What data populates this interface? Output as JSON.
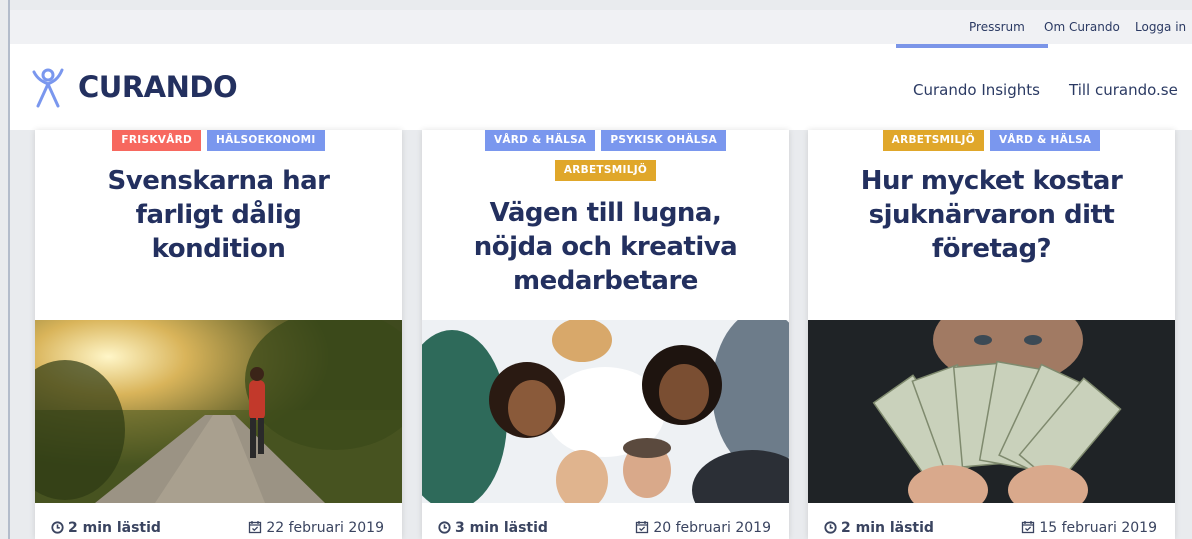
{
  "utility_nav": {
    "pressroom": "Pressrum",
    "about": "Om Curando",
    "login": "Logga in"
  },
  "header": {
    "logo_text": "CURANDO",
    "nav": {
      "insights": "Curando Insights",
      "site": "Till curando.se"
    }
  },
  "colors": {
    "brand_navy": "#23305f",
    "tag_orange": "#f7685f",
    "tag_blue": "#7a97ee",
    "tag_gold": "#e0a72a",
    "accent": "#7b95e8"
  },
  "cards": [
    {
      "tags": [
        "FRISKVÅRD",
        "HÄLSOEKONOMI"
      ],
      "title": "Svenskarna har farligt dålig kondition",
      "image": "runner-on-forest-road",
      "read_time": "2 min lästid",
      "date": "22 februari 2019"
    },
    {
      "tags": [
        "VÅRD & HÄLSA",
        "PSYKISK OHÄLSA",
        "ARBETSMILJÖ"
      ],
      "title": "Vägen till lugna, nöjda och kreativa medarbetare",
      "image": "smiling-colleagues-circle",
      "read_time": "3 min lästid",
      "date": "20 februari 2019"
    },
    {
      "tags": [
        "ARBETSMILJÖ",
        "VÅRD & HÄLSA"
      ],
      "title": "Hur mycket kostar sjuknärvaron ditt företag?",
      "image": "man-holding-dollar-bills",
      "read_time": "2 min lästid",
      "date": "15 februari 2019"
    }
  ]
}
